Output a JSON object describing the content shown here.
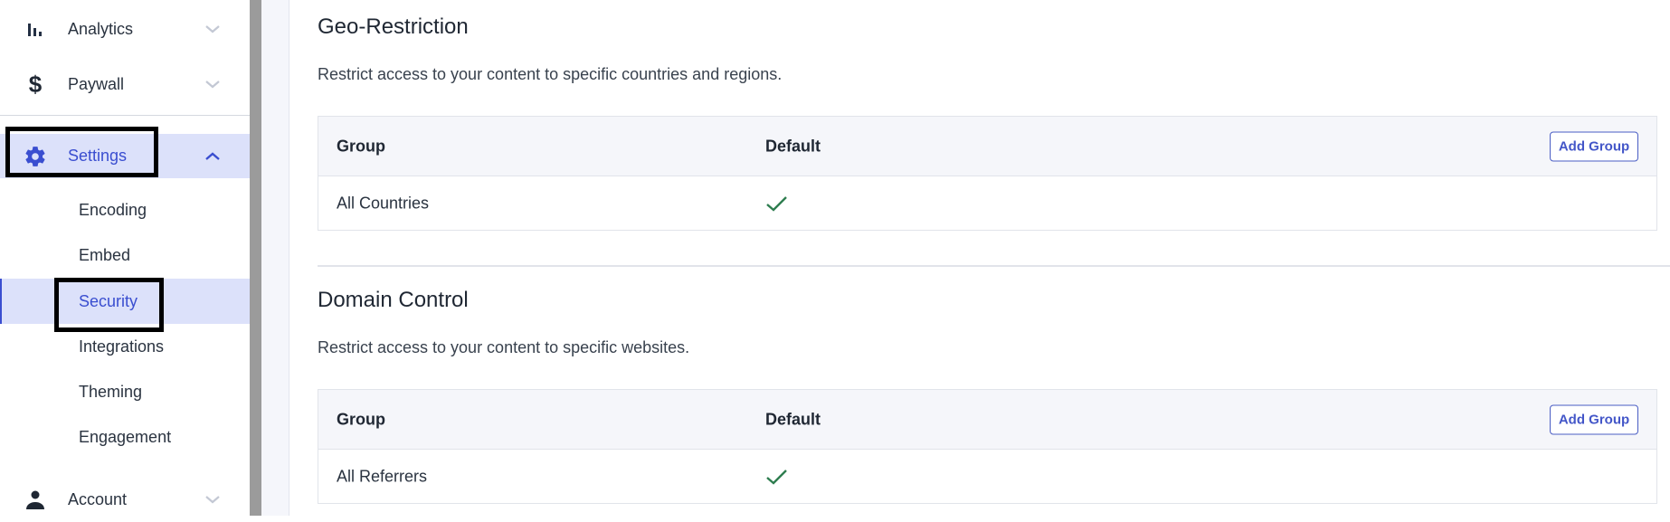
{
  "sidebar": {
    "items": [
      {
        "label": "Analytics",
        "icon": "bar-chart-icon",
        "expanded": false
      },
      {
        "label": "Paywall",
        "icon": "dollar-icon",
        "expanded": false
      },
      {
        "label": "Settings",
        "icon": "gear-icon",
        "expanded": true,
        "active": true
      },
      {
        "label": "Account",
        "icon": "person-icon",
        "expanded": false
      }
    ],
    "settings_subitems": [
      {
        "label": "Encoding"
      },
      {
        "label": "Embed"
      },
      {
        "label": "Security",
        "active": true
      },
      {
        "label": "Integrations"
      },
      {
        "label": "Theming"
      },
      {
        "label": "Engagement"
      }
    ]
  },
  "sections": [
    {
      "title": "Geo-Restriction",
      "description": "Restrict access to your content to specific countries and regions.",
      "columns": [
        "Group",
        "Default"
      ],
      "add_button": "Add Group",
      "rows": [
        {
          "group": "All Countries",
          "default": true
        }
      ]
    },
    {
      "title": "Domain Control",
      "description": "Restrict access to your content to specific websites.",
      "columns": [
        "Group",
        "Default"
      ],
      "add_button": "Add Group",
      "rows": [
        {
          "group": "All Referrers",
          "default": true
        }
      ]
    }
  ],
  "colors": {
    "accent": "#3a4ed0",
    "active_bg": "#dce1fa",
    "check_green": "#2e7d4f"
  }
}
